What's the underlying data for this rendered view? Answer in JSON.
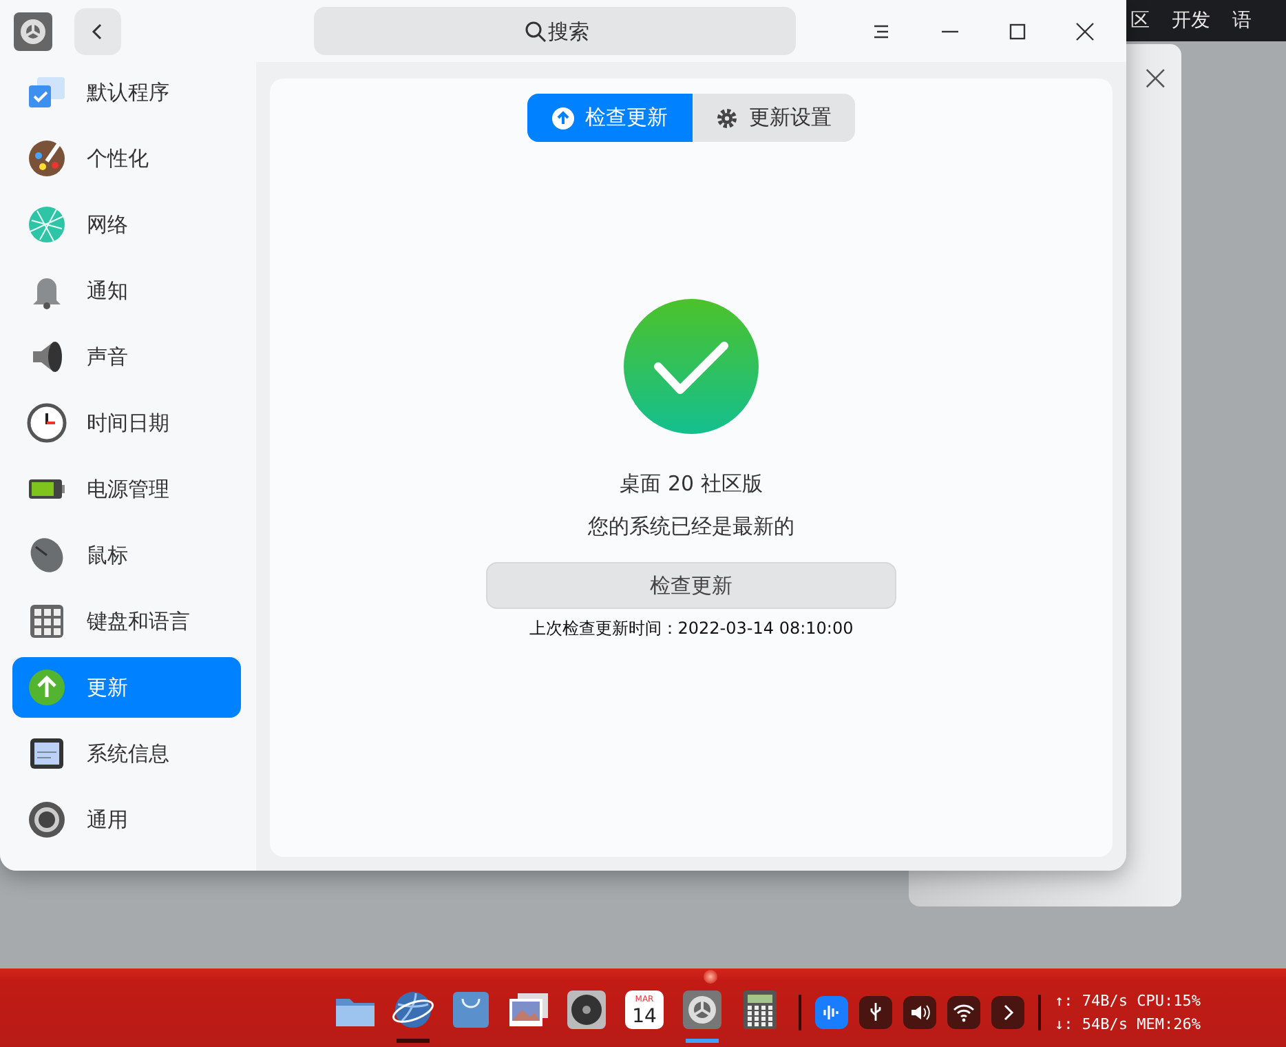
{
  "background_bar": {
    "items": [
      "区",
      "开发",
      "语"
    ]
  },
  "back_dialog": {
    "close": "×"
  },
  "window": {
    "search": {
      "placeholder": "搜索"
    }
  },
  "sidebar": {
    "items": [
      {
        "label": "默认程序",
        "selected": false
      },
      {
        "label": "个性化",
        "selected": false
      },
      {
        "label": "网络",
        "selected": false
      },
      {
        "label": "通知",
        "selected": false
      },
      {
        "label": "声音",
        "selected": false
      },
      {
        "label": "时间日期",
        "selected": false
      },
      {
        "label": "电源管理",
        "selected": false
      },
      {
        "label": "鼠标",
        "selected": false
      },
      {
        "label": "键盘和语言",
        "selected": false
      },
      {
        "label": "更新",
        "selected": true
      },
      {
        "label": "系统信息",
        "selected": false
      },
      {
        "label": "通用",
        "selected": false
      }
    ]
  },
  "tabs": [
    {
      "label": "检查更新",
      "selected": true
    },
    {
      "label": "更新设置",
      "selected": false
    }
  ],
  "status": {
    "edition": "桌面 20 社区版",
    "message": "您的系统已经是最新的",
    "button": "检查更新",
    "last_check": "上次检查更新时间：2022-03-14 08:10:00"
  },
  "taskbar": {
    "apps": [
      {
        "kind": "files",
        "running": false
      },
      {
        "kind": "browser",
        "running": true,
        "focused": false
      },
      {
        "kind": "store",
        "running": false
      },
      {
        "kind": "pictures",
        "running": false
      },
      {
        "kind": "music",
        "running": false
      },
      {
        "kind": "calendar",
        "running": false,
        "month": "MAR",
        "day": "14"
      },
      {
        "kind": "settings",
        "running": true,
        "focused": true
      },
      {
        "kind": "calculator",
        "running": false
      }
    ],
    "stats": [
      "↑: 74B/s CPU:15%",
      "↓: 54B/s MEM:26%"
    ]
  }
}
